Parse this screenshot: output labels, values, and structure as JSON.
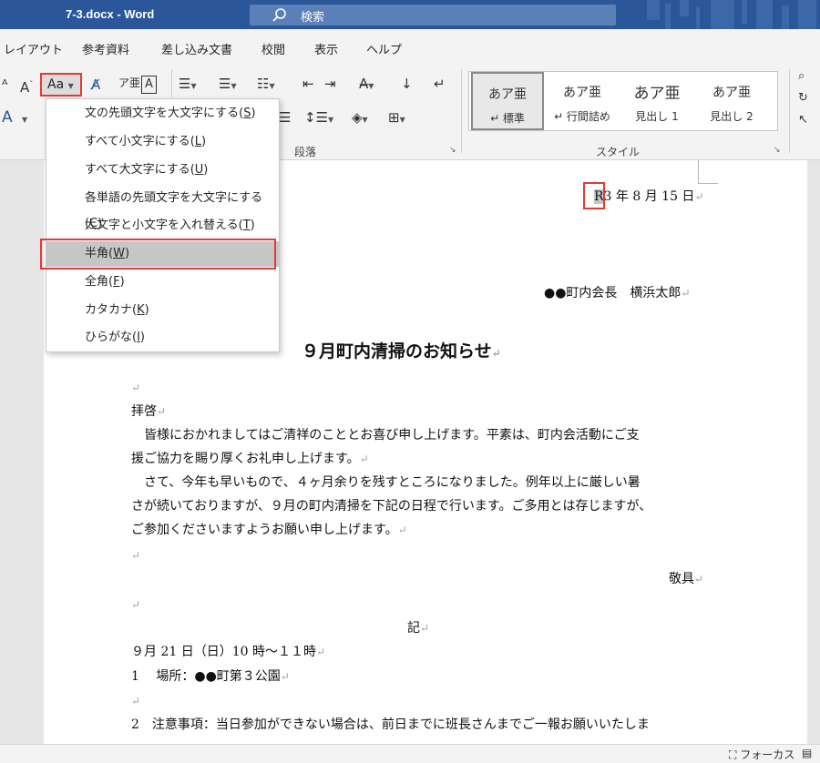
{
  "window": {
    "title": "7-3.docx  -  Word",
    "search_label": "検索"
  },
  "ribbon_tabs": [
    "レイアウト",
    "参考資料",
    "差し込み文書",
    "校閲",
    "表示",
    "ヘルプ"
  ],
  "ribbon": {
    "change_case_label": "Aa",
    "paragraph_group": "段落",
    "styles_group": "スタイル",
    "styles": [
      {
        "sample": "あア亜",
        "name": "↵ 標準"
      },
      {
        "sample": "あア亜",
        "name": "↵ 行間詰め"
      },
      {
        "sample": "あア亜",
        "name": "見出し 1"
      },
      {
        "sample": "あア亜",
        "name": "見出し 2"
      }
    ]
  },
  "change_case_menu": {
    "items": [
      {
        "text": "文の先頭文字を大文字にする(",
        "key": "S",
        "tail": ")"
      },
      {
        "text": "すべて小文字にする(",
        "key": "L",
        "tail": ")"
      },
      {
        "text": "すべて大文字にする(",
        "key": "U",
        "tail": ")"
      },
      {
        "text": "各単語の先頭文字を大文字にする(",
        "key": "C",
        "tail": ")"
      },
      {
        "text": "大文字と小文字を入れ替える(",
        "key": "T",
        "tail": ")"
      },
      {
        "text": "半角(",
        "key": "W",
        "tail": ")"
      },
      {
        "text": "全角(",
        "key": "F",
        "tail": ")"
      },
      {
        "text": "カタカナ(",
        "key": "K",
        "tail": ")"
      },
      {
        "text": "ひらがな(",
        "key": "I",
        "tail": ")"
      }
    ],
    "highlighted_index": 5
  },
  "document": {
    "date_selected": "R",
    "date_rest": "3 年 8 月 15 日",
    "sender": "●●町内会長　横浜太郎",
    "title": "９月町内清掃のお知らせ",
    "greeting": "拝啓",
    "p1_line1": "　皆様におかれましてはご清祥のこととお喜び申し上げます。平素は、町内会活動にご支",
    "p1_line2": "援ご協力を賜り厚くお礼申し上げます。",
    "p2_line1": "　さて、今年も早いもので、４ヶ月余りを残すところになりました。例年以上に厳しい暑",
    "p2_line2": "さが続いておりますが、９月の町内清掃を下記の日程で行います。ご多用とは存じますが、",
    "p2_line3": "ご参加くださいますようお願い申し上げます。",
    "closing": "敬具",
    "ki": "記",
    "item_date": "９月 21 日（日）10 時～１１時",
    "item1": "1　 場所：●●町第３公園",
    "item2": "2　注意事項：当日参加ができない場合は、前日までに班長さんまでご一報お願いいたしま"
  },
  "status_bar": {
    "focus": "フォーカス"
  },
  "colors": {
    "title_bar": "#2b579a",
    "highlight_box": "#e53935"
  }
}
